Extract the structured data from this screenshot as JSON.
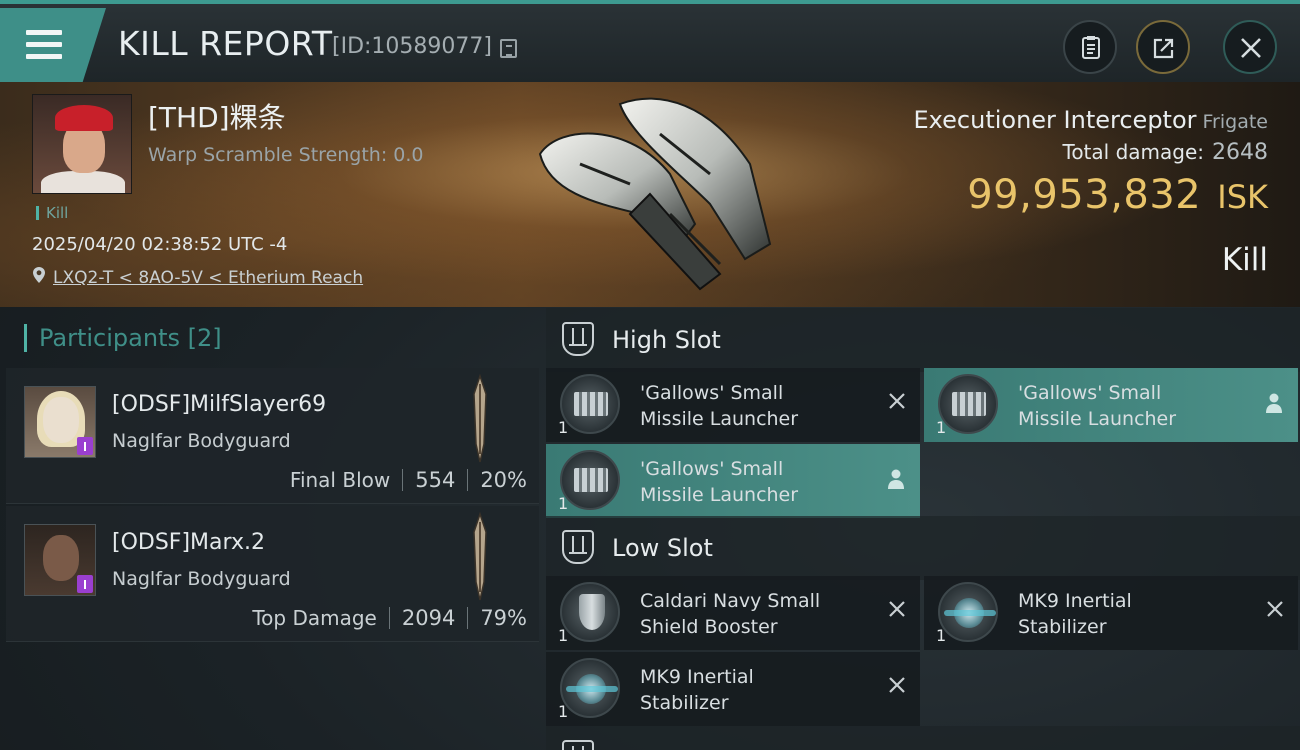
{
  "header": {
    "title": "KILL REPORT",
    "id_text": "[ID:10589077]"
  },
  "victim": {
    "name": "[THD]粿条",
    "warp_scramble": "Warp Scramble Strength: 0.0",
    "tag": "Kill",
    "datetime": "2025/04/20 02:38:52 UTC -4",
    "location": "LXQ2-T < 8AO-5V < Etherium Reach",
    "ship": "Executioner Interceptor",
    "ship_class": "Frigate",
    "total_damage_label": "Total damage:",
    "total_damage": "2648",
    "isk_value": "99,953,832",
    "isk_unit": "ISK",
    "result": "Kill"
  },
  "participants": {
    "label": "Participants [2]",
    "items": [
      {
        "name": "[ODSF]MilfSlayer69",
        "ship": "Naglfar Bodyguard",
        "role": "Final Blow",
        "damage": "554",
        "percent": "20%"
      },
      {
        "name": "[ODSF]Marx.2",
        "ship": "Naglfar Bodyguard",
        "role": "Top Damage",
        "damage": "2094",
        "percent": "79%"
      }
    ]
  },
  "slots": {
    "high": {
      "label": "High Slot",
      "items": [
        {
          "name_line1": "'Gallows' Small",
          "name_line2": "Missile Launcher",
          "qty": "1",
          "status": "destroyed"
        },
        {
          "name_line1": "'Gallows' Small",
          "name_line2": "Missile Launcher",
          "qty": "1",
          "status": "dropped"
        },
        {
          "name_line1": "'Gallows' Small",
          "name_line2": "Missile Launcher",
          "qty": "1",
          "status": "dropped"
        }
      ]
    },
    "low": {
      "label": "Low Slot",
      "items": [
        {
          "name_line1": "Caldari Navy Small",
          "name_line2": "Shield Booster",
          "qty": "1",
          "status": "destroyed"
        },
        {
          "name_line1": "MK9 Inertial",
          "name_line2": "Stabilizer",
          "qty": "1",
          "status": "destroyed"
        },
        {
          "name_line1": "MK9 Inertial",
          "name_line2": "Stabilizer",
          "qty": "1",
          "status": "destroyed"
        }
      ]
    }
  },
  "colors": {
    "accent": "#4fb3a6",
    "isk": "#e9c46a",
    "dropped_item_bg": "#4c9088"
  }
}
